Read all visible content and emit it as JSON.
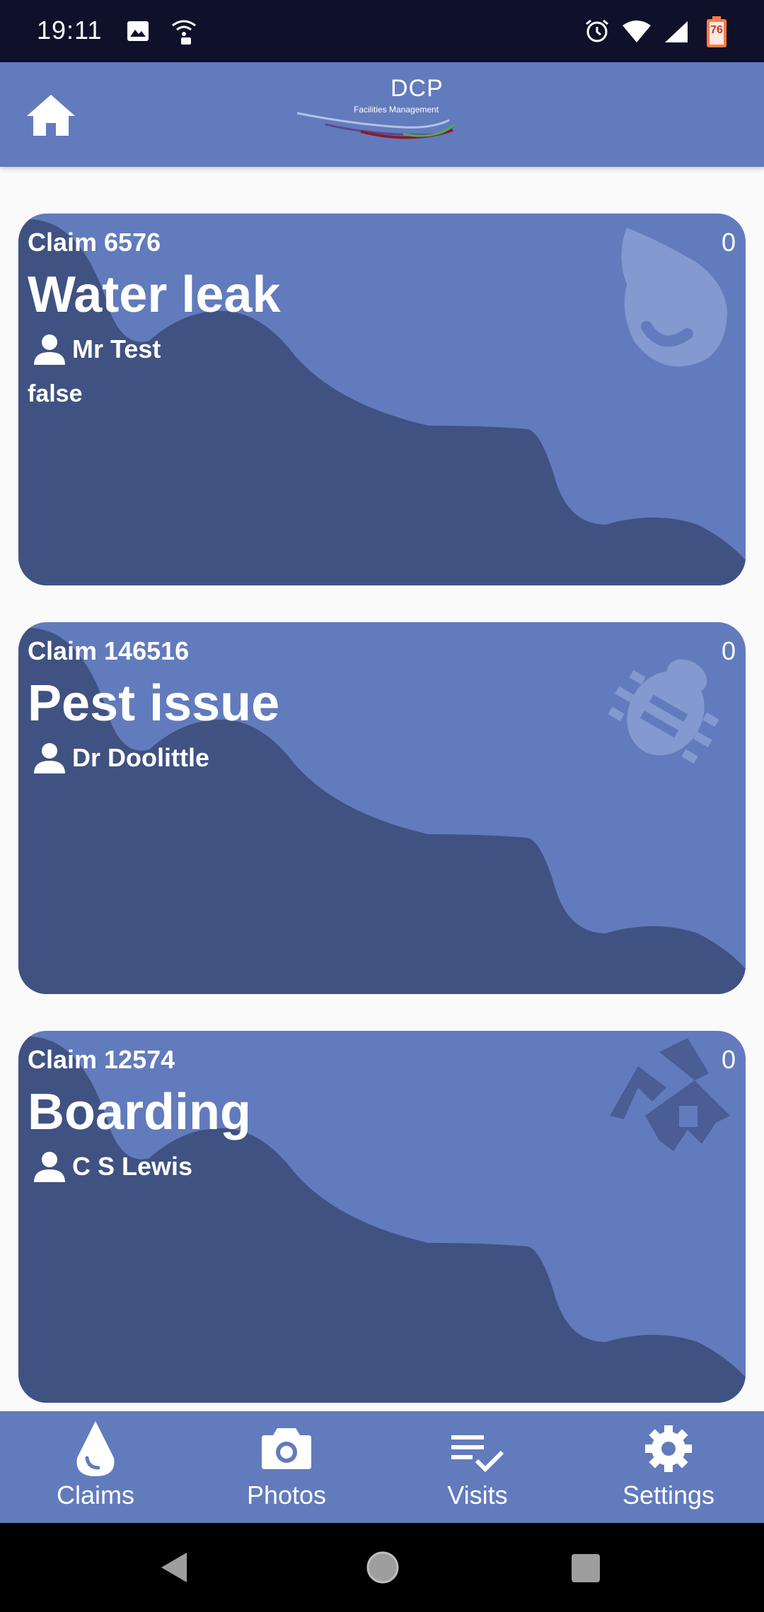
{
  "status_bar": {
    "time": "19:11",
    "battery_level": "76"
  },
  "app_bar": {
    "logo_title": "DCP",
    "logo_subtitle": "Facilities Management"
  },
  "claims": [
    {
      "claim_label": "Claim 6576",
      "count": "0",
      "title": "Water leak",
      "person": "Mr Test",
      "status": "false",
      "icon": "water-drop-icon"
    },
    {
      "claim_label": "Claim 146516",
      "count": "0",
      "title": "Pest issue",
      "person": "Dr Doolittle",
      "icon": "bug-icon"
    },
    {
      "claim_label": "Claim 12574",
      "count": "0",
      "title": "Boarding",
      "person": "C S Lewis",
      "icon": "broken-house-icon"
    }
  ],
  "bottom_nav": {
    "items": [
      {
        "label": "Claims",
        "icon": "water-drop-icon"
      },
      {
        "label": "Photos",
        "icon": "camera-icon"
      },
      {
        "label": "Visits",
        "icon": "checklist-icon"
      },
      {
        "label": "Settings",
        "icon": "gear-icon"
      }
    ]
  },
  "colors": {
    "primary": "#627bbd",
    "wave_dark": "#405282",
    "status_bar": "#0f1029"
  }
}
